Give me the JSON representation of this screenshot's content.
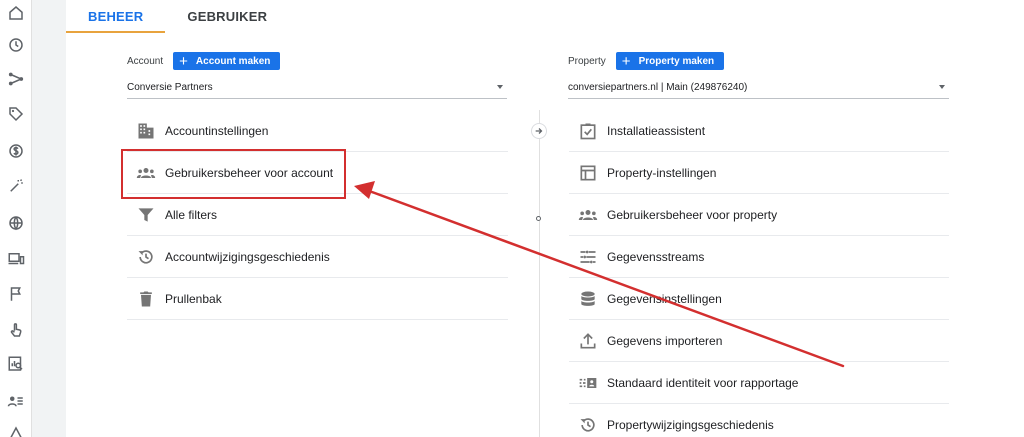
{
  "tabs": [
    {
      "label": "BEHEER",
      "active": true
    },
    {
      "label": "GEBRUIKER",
      "active": false
    }
  ],
  "rail_icons": [
    "home-icon",
    "clock-icon",
    "explore-icon",
    "tag-icon",
    "dollar-icon",
    "magic-wand-icon",
    "globe-icon",
    "devices-icon",
    "flag-icon",
    "touch-icon",
    "report-search-icon",
    "user-list-icon",
    "triangle-icon"
  ],
  "account": {
    "label": "Account",
    "button": "Account maken",
    "selected": "Conversie Partners",
    "items": [
      {
        "label": "Accountinstellingen",
        "icon": "building-icon"
      },
      {
        "label": "Gebruikersbeheer voor account",
        "icon": "people-icon"
      },
      {
        "label": "Alle filters",
        "icon": "filter-icon"
      },
      {
        "label": "Accountwijzigingsgeschiedenis",
        "icon": "history-icon"
      },
      {
        "label": "Prullenbak",
        "icon": "trash-icon"
      }
    ]
  },
  "property": {
    "label": "Property",
    "button": "Property maken",
    "selected": "conversiepartners.nl | Main (249876240)",
    "items": [
      {
        "label": "Installatieassistent",
        "icon": "checkbox-icon"
      },
      {
        "label": "Property-instellingen",
        "icon": "layout-icon"
      },
      {
        "label": "Gebruikersbeheer voor property",
        "icon": "people-icon"
      },
      {
        "label": "Gegevensstreams",
        "icon": "streams-icon"
      },
      {
        "label": "Gegevensinstellingen",
        "icon": "database-icon"
      },
      {
        "label": "Gegevens importeren",
        "icon": "upload-icon"
      },
      {
        "label": "Standaard identiteit voor rapportage",
        "icon": "identity-icon"
      },
      {
        "label": "Propertywijzigingsgeschiedenis",
        "icon": "history-icon"
      }
    ]
  },
  "colors": {
    "accent": "#1a73e8",
    "tab_underline": "#e8a33d",
    "annotation": "#d32f2f"
  }
}
